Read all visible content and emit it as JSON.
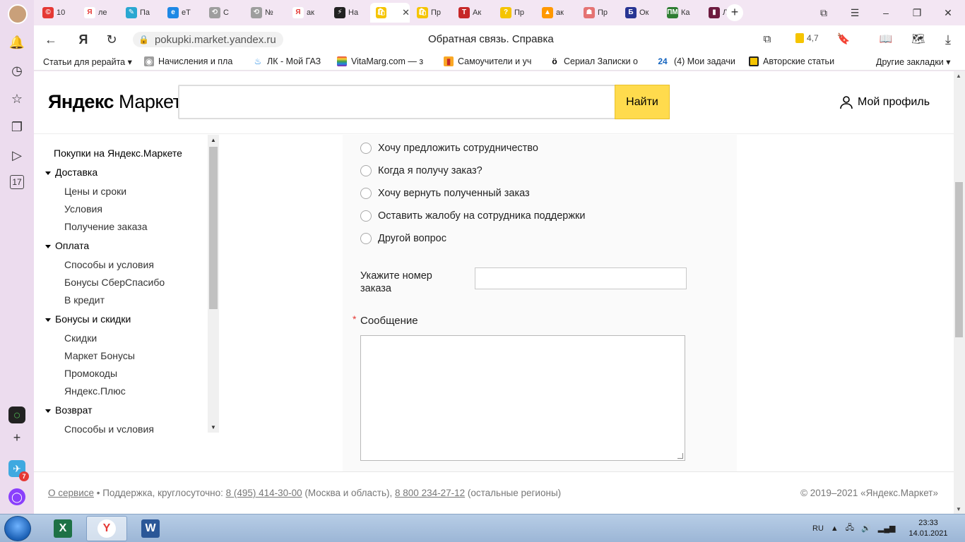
{
  "browser": {
    "tabs": [
      {
        "label": "10",
        "fav_color": "#e53935",
        "fav_char": "©"
      },
      {
        "label": "ле",
        "fav_color": "#ffffff",
        "fav_char": "Я"
      },
      {
        "label": "Па",
        "fav_color": "#2aa7d1",
        "fav_char": "✎"
      },
      {
        "label": "еТ",
        "fav_color": "#1e88e5",
        "fav_char": "e"
      },
      {
        "label": "С",
        "fav_color": "#9e9e9e",
        "fav_char": "⟲"
      },
      {
        "label": "№",
        "fav_color": "#9e9e9e",
        "fav_char": "⟲"
      },
      {
        "label": "ак",
        "fav_color": "#ffffff",
        "fav_char": "Я"
      },
      {
        "label": "На",
        "fav_color": "#222222",
        "fav_char": "⚡"
      },
      {
        "label": "",
        "fav_color": "#f5c400",
        "fav_char": "🛍",
        "active": true
      },
      {
        "label": "Пр",
        "fav_color": "#f5c400",
        "fav_char": "🛍"
      },
      {
        "label": "Ак",
        "fav_color": "#c62828",
        "fav_char": "T"
      },
      {
        "label": "Пр",
        "fav_color": "#f5c400",
        "fav_char": "?"
      },
      {
        "label": "ак",
        "fav_color": "#ff9800",
        "fav_char": "▲"
      },
      {
        "label": "Пр",
        "fav_color": "#e57373",
        "fav_char": "☗"
      },
      {
        "label": "Ок",
        "fav_color": "#283593",
        "fav_char": "Б"
      },
      {
        "label": "Ка",
        "fav_color": "#2e7d32",
        "fav_char": "ПМ"
      },
      {
        "label": "Ли",
        "fav_color": "#6d1b3f",
        "fav_char": "▮"
      }
    ],
    "tab_close": "✕",
    "new_tab": "+",
    "url": "pokupki.market.yandex.ru",
    "page_title": "Обратная связь. Справка",
    "rating": "4,7",
    "bookmarks": [
      "Статьи для рерайта ▾",
      "Начисления и пла",
      "ЛК - Мой ГАЗ",
      "VitaMarg.com — з",
      "Самоучители и уч",
      "Сериал Записки о",
      "(4) Мои задачи",
      "Авторские статьи",
      "Другие закладки ▾"
    ],
    "bookmark_24": "24"
  },
  "header": {
    "logo_bold": "Яндекс",
    "logo_rest": " Маркет",
    "search_button": "Найти",
    "profile": "Мой профиль"
  },
  "sidebar": {
    "root": "Покупки на Яндекс.Маркете",
    "sections": [
      {
        "label": "Доставка",
        "items": [
          "Цены и сроки",
          "Условия",
          "Получение заказа"
        ]
      },
      {
        "label": "Оплата",
        "items": [
          "Способы и условия",
          "Бонусы СберСпасибо",
          "В кредит"
        ]
      },
      {
        "label": "Бонусы и скидки",
        "items": [
          "Скидки",
          "Маркет Бонусы",
          "Промокоды",
          "Яндекс.Плюс"
        ]
      },
      {
        "label": "Возврат",
        "items": [
          "Способы и условия"
        ]
      }
    ]
  },
  "form": {
    "options": [
      "Хочу предложить сотрудничество",
      "Когда я получу заказ?",
      "Хочу вернуть полученный заказ",
      "Оставить жалобу на сотрудника поддержки",
      "Другой вопрос"
    ],
    "order_label": "Укажите номер заказа",
    "order_value": "",
    "message_required": "*",
    "message_label": "Сообщение",
    "message_value": ""
  },
  "footer": {
    "about": "О сервисе",
    "support": " • Поддержка, круглосуточно: ",
    "phone1": "8 (495) 414-30-00",
    "region1": " (Москва и область), ",
    "phone2": "8 800 234-27-12",
    "region2": " (остальные регионы)",
    "copyright": "© 2019–2021  «Яндекс.Маркет»"
  },
  "taskbar": {
    "lang": "RU",
    "time": "23:33",
    "date": "14.01.2021",
    "badge": "7"
  }
}
